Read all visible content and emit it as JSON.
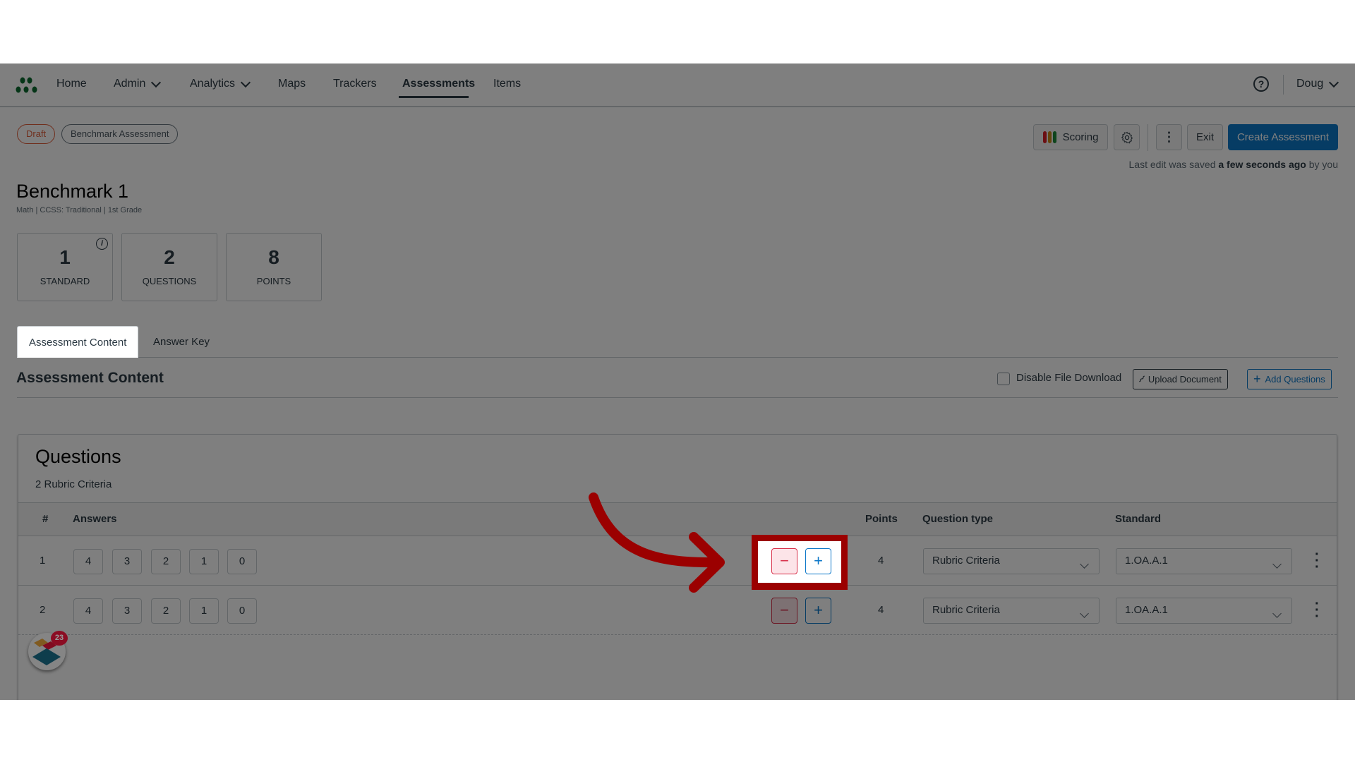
{
  "nav": {
    "items": [
      {
        "label": "Home",
        "has_dropdown": false,
        "active": false
      },
      {
        "label": "Admin",
        "has_dropdown": true,
        "active": false
      },
      {
        "label": "Analytics",
        "has_dropdown": true,
        "active": false
      },
      {
        "label": "Maps",
        "has_dropdown": false,
        "active": false
      },
      {
        "label": "Trackers",
        "has_dropdown": false,
        "active": false
      },
      {
        "label": "Assessments",
        "has_dropdown": false,
        "active": true
      },
      {
        "label": "Items",
        "has_dropdown": false,
        "active": false
      }
    ],
    "help_icon": "question-circle-icon",
    "user": "Doug",
    "logo_color": "#0a6b2e"
  },
  "header": {
    "status_pill": "Draft",
    "type_pill": "Benchmark Assessment",
    "title": "Benchmark 1",
    "subtitle": "Math  |  CCSS: Traditional  |  1st Grade",
    "scoring_label": "Scoring",
    "scoring_colors": [
      "#d91f26",
      "#c98a1a",
      "#1f8a3a"
    ],
    "exit_label": "Exit",
    "create_label": "Create Assessment",
    "saved_prefix": "Last edit was saved ",
    "saved_bold": "a few seconds ago",
    "saved_suffix": " by you"
  },
  "stats": [
    {
      "value": "1",
      "label": "STANDARD",
      "info": "i"
    },
    {
      "value": "2",
      "label": "QUESTIONS"
    },
    {
      "value": "8",
      "label": "POINTS"
    }
  ],
  "tabs": [
    {
      "label": "Assessment Content",
      "active": true
    },
    {
      "label": "Answer Key",
      "active": false
    }
  ],
  "content": {
    "section_title": "Assessment Content",
    "disable_download_label": "Disable File Download",
    "disable_download_checked": false,
    "upload_label": "Upload Document",
    "add_questions_label": "Add Questions"
  },
  "questions": {
    "title": "Questions",
    "subtitle": "2 Rubric Criteria",
    "columns": [
      "#",
      "Answers",
      "Points",
      "Question type",
      "Standard"
    ],
    "rows": [
      {
        "num": "1",
        "answers": [
          "4",
          "3",
          "2",
          "1",
          "0"
        ],
        "minus": "−",
        "plus": "+",
        "points": "4",
        "question_type": "Rubric Criteria",
        "standard": "1.OA.A.1"
      },
      {
        "num": "2",
        "answers": [
          "4",
          "3",
          "2",
          "1",
          "0"
        ],
        "minus": "−",
        "plus": "+",
        "points": "4",
        "question_type": "Rubric Criteria",
        "standard": "1.OA.A.1"
      }
    ],
    "add_button_label": "dd Questions"
  },
  "widget": {
    "badge_count": "23"
  },
  "annotation": {
    "highlight_color": "#9b0000",
    "target": "row-1 minus/plus buttons"
  }
}
